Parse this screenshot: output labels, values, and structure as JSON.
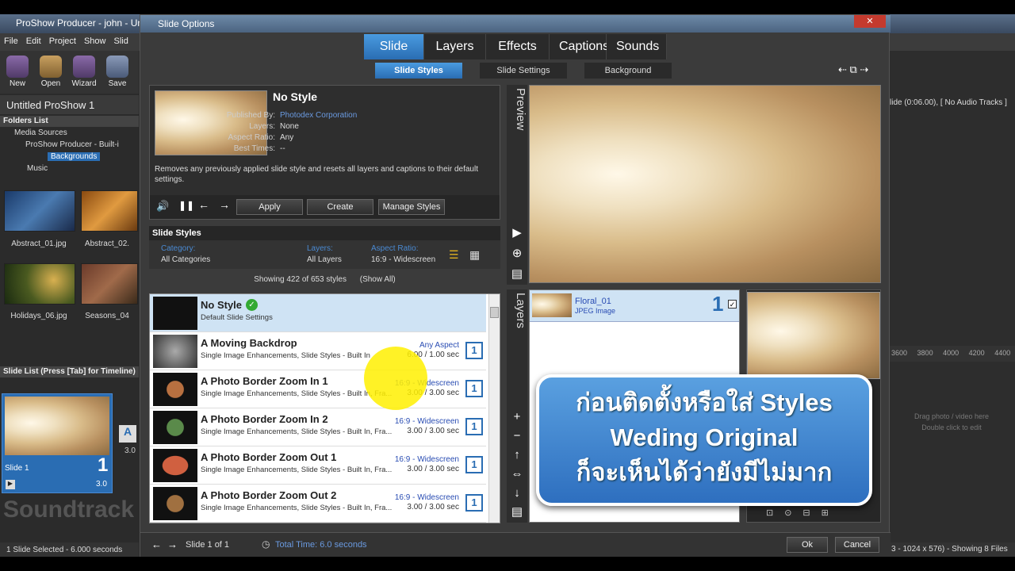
{
  "app": {
    "title": "ProShow Producer - john - Un",
    "menu": [
      "File",
      "Edit",
      "Project",
      "Show",
      "Slid"
    ],
    "tools": [
      "New",
      "Open",
      "Wizard",
      "Save"
    ],
    "show_title": "Untitled ProShow 1",
    "folders_header": "Folders List",
    "folders": [
      "Media Sources",
      "ProShow Producer - Built-i",
      "Backgrounds",
      "Music"
    ],
    "thumbs": [
      "Abstract_01.jpg",
      "Abstract_02.",
      "Holidays_06.jpg",
      "Seasons_04"
    ],
    "slide_list_header": "Slide List (Press [Tab] for Timeline)",
    "slide_label": "Slide 1",
    "slide_number": "1",
    "slide_time": "3.0",
    "next_time": "3.0",
    "soundtrack": "Soundtrack",
    "status": "1 Slide Selected - 6.000 seconds",
    "right_info": "lide (0:06.00), [ No Audio Tracks ]",
    "ruler": [
      "3600",
      "3800",
      "4000",
      "4200",
      "4400"
    ],
    "drag_hint_1": "Drag photo / video here",
    "drag_hint_2": "Double click to edit",
    "right_status": "3 - 1024 x 576) - Showing 8 Files"
  },
  "dialog": {
    "title": "Slide Options",
    "close": "✕",
    "tabs": [
      "Slide",
      "Layers",
      "Effects",
      "Captions",
      "Sounds"
    ],
    "subtabs": [
      "Slide Styles",
      "Slide Settings",
      "Background"
    ],
    "style_name": "No Style",
    "info": {
      "published_by_label": "Published By:",
      "published_by": "Photodex Corporation",
      "layers_label": "Layers:",
      "layers": "None",
      "aspect_label": "Aspect Ratio:",
      "aspect": "Any",
      "best_times_label": "Best Times:",
      "best_times": "--"
    },
    "description": "Removes any previously applied slide style and resets all layers and captions to their default settings.",
    "buttons": {
      "apply": "Apply",
      "create": "Create",
      "manage": "Manage Styles"
    },
    "slide_styles_header": "Slide Styles",
    "filters": {
      "category_label": "Category:",
      "category": "All Categories",
      "layers_label": "Layers:",
      "layers": "All Layers",
      "aspect_label": "Aspect Ratio:",
      "aspect": "16:9 - Widescreen"
    },
    "showing": "Showing 422 of 653 styles",
    "show_all": "(Show All)",
    "styles": [
      {
        "name": "No Style",
        "desc": "Default Slide Settings",
        "aspect": "",
        "time": "",
        "badge": ""
      },
      {
        "name": "A Moving Backdrop",
        "desc": "Single Image Enhancements, Slide Styles - Built In",
        "aspect": "Any Aspect",
        "time": "6.00 / 1.00 sec",
        "badge": "1"
      },
      {
        "name": "A Photo Border Zoom In 1",
        "desc": "Single Image Enhancements, Slide Styles - Built In, Fra...",
        "aspect": "16:9 - Widescreen",
        "time": "3.00 / 3.00 sec",
        "badge": "1"
      },
      {
        "name": "A Photo Border Zoom In 2",
        "desc": "Single Image Enhancements, Slide Styles - Built In, Fra...",
        "aspect": "16:9 - Widescreen",
        "time": "3.00 / 3.00 sec",
        "badge": "1"
      },
      {
        "name": "A Photo Border Zoom Out 1",
        "desc": "Single Image Enhancements, Slide Styles - Built In, Fra...",
        "aspect": "16:9 - Widescreen",
        "time": "3.00 / 3.00 sec",
        "badge": "1"
      },
      {
        "name": "A Photo Border Zoom Out 2",
        "desc": "Single Image Enhancements, Slide Styles - Built In, Fra...",
        "aspect": "16:9 - Widescreen",
        "time": "3.00 / 3.00 sec",
        "badge": "1"
      }
    ],
    "preview_label": "Preview",
    "layers_label": "Layers",
    "layer": {
      "name": "Floral_01",
      "type": "JPEG Image",
      "number": "1"
    },
    "footer": {
      "slide_of": "Slide 1 of 1",
      "total_time": "Total Time: 6.0 seconds",
      "ok": "Ok",
      "cancel": "Cancel"
    }
  },
  "callout": {
    "line1": "ก่อนติดตั้งหรือใส่ Styles",
    "line2": "Weding Original",
    "line3": "ก็จะเห็นได้ว่ายังมีไม่มาก"
  }
}
